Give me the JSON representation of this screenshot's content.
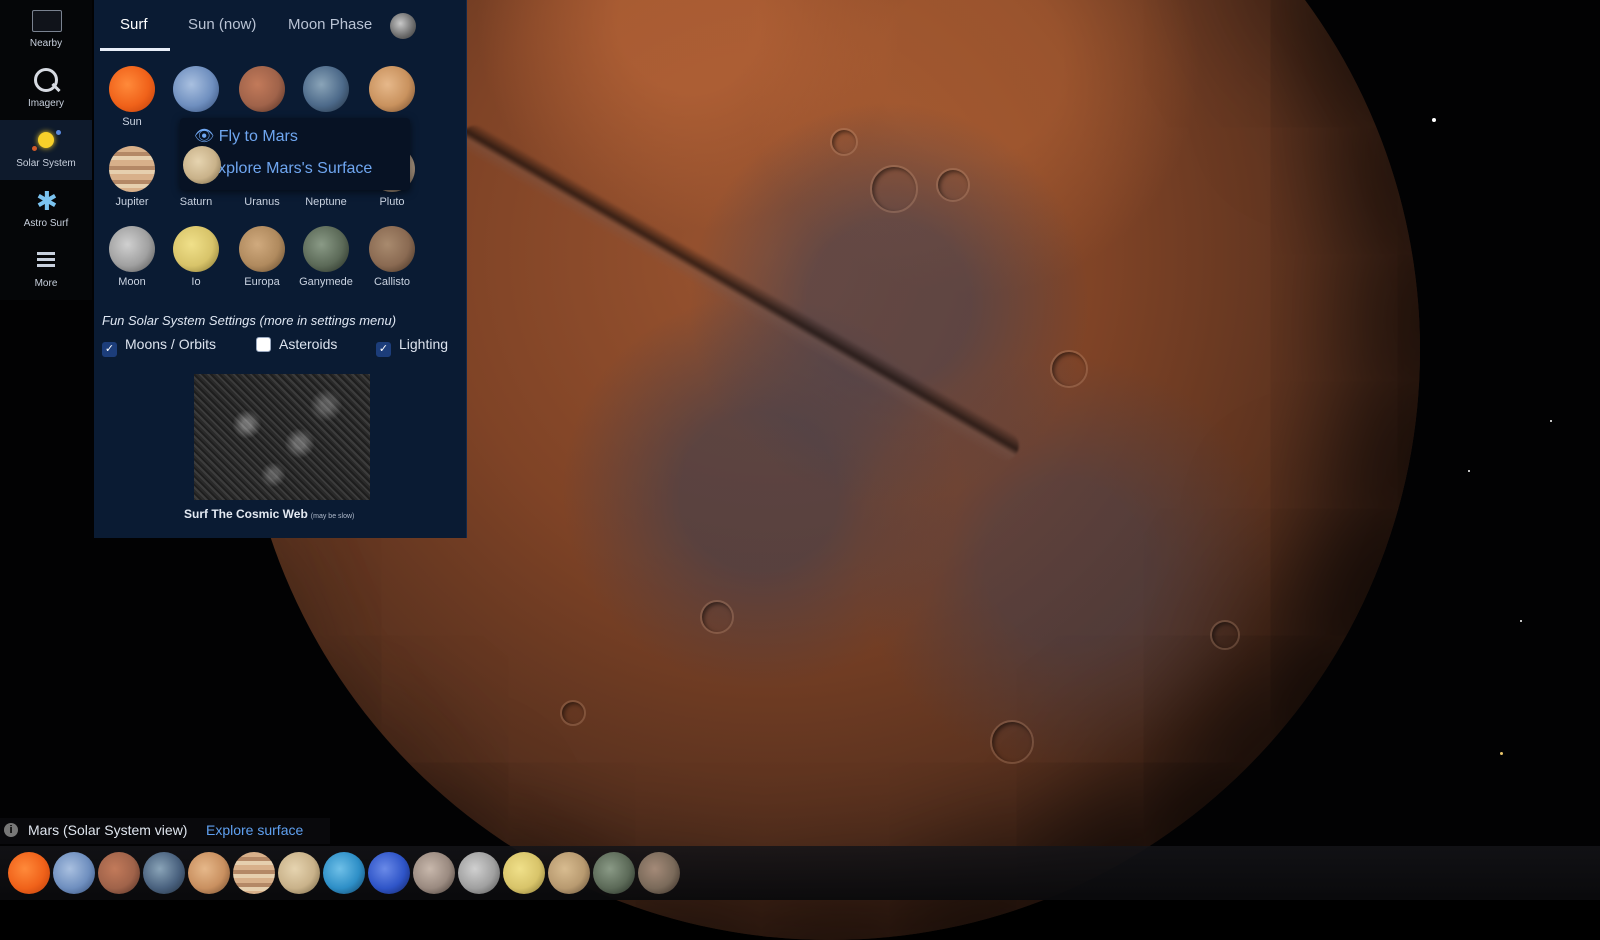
{
  "rail": {
    "items": [
      {
        "label": "Nearby",
        "icon": "display-icon"
      },
      {
        "label": "Imagery",
        "icon": "magnifier-icon"
      },
      {
        "label": "Solar System",
        "icon": "sun-system-icon"
      },
      {
        "label": "Astro Surf",
        "icon": "astronaut-icon"
      },
      {
        "label": "More",
        "icon": "menu-icon"
      }
    ]
  },
  "panel": {
    "tabs": [
      {
        "label": "Surf"
      },
      {
        "label": "Sun (now)"
      },
      {
        "label": "Moon Phase"
      }
    ],
    "bodies_row1": [
      {
        "label": "Sun",
        "color": "#f0621a"
      },
      {
        "label": "",
        "color": "#7f9cc8"
      },
      {
        "label": "",
        "color": "#a85a3c"
      },
      {
        "label": "",
        "color": "#4d6a8a"
      },
      {
        "label": "",
        "color": "#c9925e"
      }
    ],
    "bodies_row2": [
      {
        "label": "Jupiter",
        "color": "#c9a07a"
      },
      {
        "label": "Saturn",
        "color": "#c9b28a"
      },
      {
        "label": "Uranus",
        "color": "#7fb6c9"
      },
      {
        "label": "Neptune",
        "color": "#3a5fc2"
      },
      {
        "label": "Pluto",
        "color": "#b8a38e"
      }
    ],
    "bodies_row3": [
      {
        "label": "Moon",
        "color": "#a8a8a8"
      },
      {
        "label": "Io",
        "color": "#d8c46a"
      },
      {
        "label": "Europa",
        "color": "#b08a5e"
      },
      {
        "label": "Ganymede",
        "color": "#5c6a58"
      },
      {
        "label": "Callisto",
        "color": "#8a6a52"
      }
    ],
    "context_menu": {
      "fly": "Fly to Mars",
      "explore": "Explore Mars's Surface"
    },
    "settings_title": "Fun Solar System Settings (more in settings menu)",
    "checks": [
      {
        "label": "Moons / Orbits",
        "checked": true
      },
      {
        "label": "Asteroids",
        "checked": false
      },
      {
        "label": "Lighting",
        "checked": true
      }
    ],
    "cosmic_label": "Surf The Cosmic Web",
    "cosmic_note": "(may be slow)"
  },
  "status": {
    "text": "Mars (Solar System view)",
    "link": "Explore surface"
  },
  "strip": {
    "colors": [
      "#f0621a",
      "#6f8fbf",
      "#a0634a",
      "#4a627f",
      "#c99060",
      "#cfa676",
      "#c9b28a",
      "#2e8fc7",
      "#2f55c8",
      "#9a8a80",
      "#a0a0a0",
      "#d8c46a",
      "#b89a70",
      "#5c6a58",
      "#7a6a5a"
    ]
  }
}
